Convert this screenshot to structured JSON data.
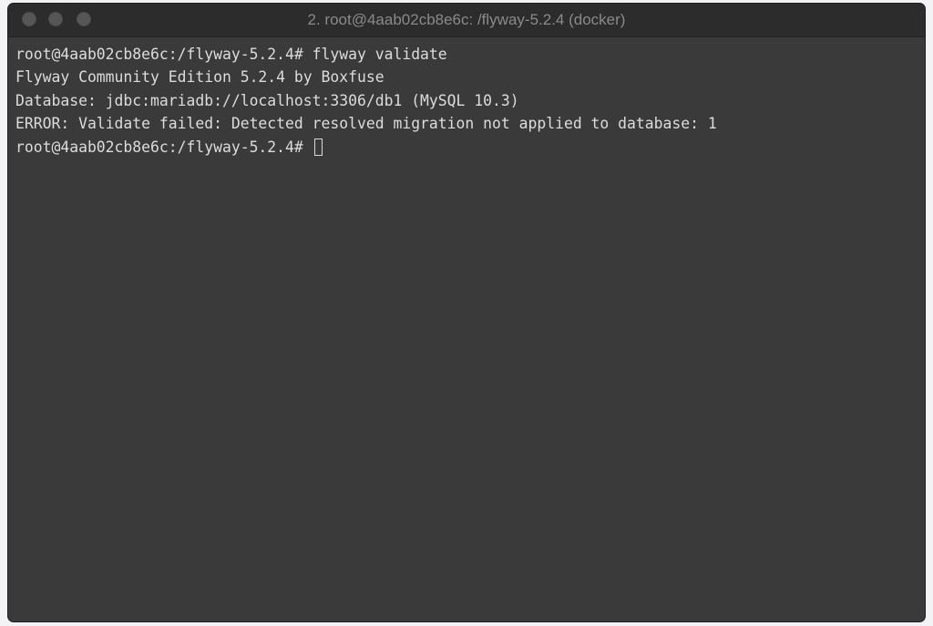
{
  "window": {
    "title": "2. root@4aab02cb8e6c: /flyway-5.2.4 (docker)"
  },
  "terminal": {
    "lines": [
      "root@4aab02cb8e6c:/flyway-5.2.4# flyway validate",
      "Flyway Community Edition 5.2.4 by Boxfuse",
      "Database: jdbc:mariadb://localhost:3306/db1 (MySQL 10.3)",
      "ERROR: Validate failed: Detected resolved migration not applied to database: 1"
    ],
    "prompt": "root@4aab02cb8e6c:/flyway-5.2.4# "
  },
  "colors": {
    "background": "#3a3a3a",
    "titlebar": "#2c2c2c",
    "text": "#dcdcdc"
  }
}
